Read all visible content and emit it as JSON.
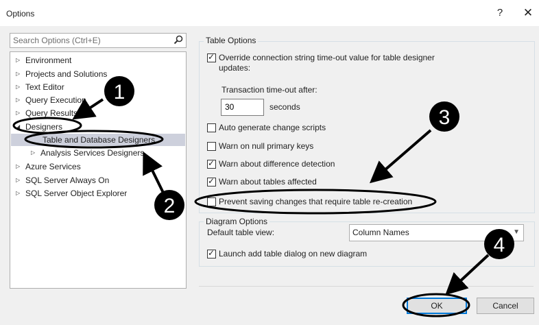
{
  "window": {
    "title": "Options",
    "help_icon": "?",
    "close_icon": "✕"
  },
  "search": {
    "placeholder": "Search Options (Ctrl+E)",
    "icon": "search-icon"
  },
  "tree": {
    "items": [
      {
        "label": "Environment"
      },
      {
        "label": "Projects and Solutions"
      },
      {
        "label": "Text Editor"
      },
      {
        "label": "Query Execution"
      },
      {
        "label": "Query Results"
      },
      {
        "label": "Designers"
      },
      {
        "label": "Table and Database Designers",
        "selected": true
      },
      {
        "label": "Analysis Services Designers"
      },
      {
        "label": "Azure Services"
      },
      {
        "label": "SQL Server Always On"
      },
      {
        "label": "SQL Server Object Explorer"
      }
    ]
  },
  "table_options": {
    "label": "Table Options",
    "override_timeout": {
      "label": "Override connection string time-out value for table designer",
      "label2": "updates:",
      "checked": true
    },
    "transaction_timeout_label": "Transaction time-out after:",
    "transaction_timeout_value": "30",
    "seconds_label": "seconds",
    "auto_generate": {
      "label": "Auto generate change scripts",
      "checked": false
    },
    "warn_null_pk": {
      "label": "Warn on null primary keys",
      "checked": false
    },
    "warn_difference": {
      "label": "Warn about difference detection",
      "checked": true
    },
    "warn_tables": {
      "label": "Warn about tables affected",
      "checked": true
    },
    "prevent_saving": {
      "label": "Prevent saving changes that require table re-creation",
      "checked": false
    }
  },
  "diagram_options": {
    "label": "Diagram Options",
    "default_view_label": "Default table view:",
    "default_view_value": "Column Names",
    "launch_add_table": {
      "label": "Launch add table dialog on new diagram",
      "checked": true
    }
  },
  "buttons": {
    "ok": "OK",
    "cancel": "Cancel"
  },
  "annotations": {
    "badges": [
      "1",
      "2",
      "3",
      "4"
    ],
    "color": "#000000"
  }
}
